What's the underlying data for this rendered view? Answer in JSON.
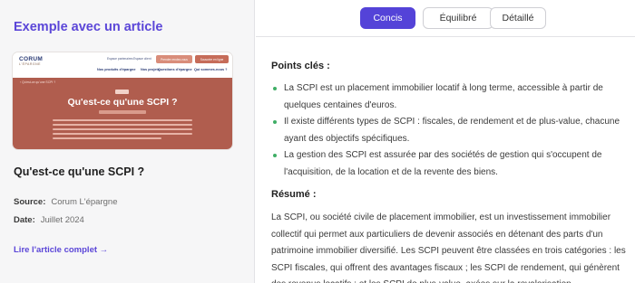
{
  "left_panel": {
    "heading": "Exemple avec un article",
    "thumbnail": {
      "logo": "CORUM",
      "logo_sub": "L'ÉPARGNE",
      "top_links": [
        "Espace partenaires",
        "Espace client"
      ],
      "buttons": [
        "Prendre rendez-vous",
        "Souscrire en ligne"
      ],
      "nav": [
        "Nos produits d'épargne",
        "Nos projets",
        "Questions d'épargne",
        "Qui sommes-nous ?"
      ],
      "breadcrumb": "›   Qu'est-ce qu'une SCPI ?",
      "headline": "Qu'est-ce qu'une SCPI ?"
    },
    "article_title": "Qu'est-ce qu'une SCPI ?",
    "source_label": "Source:",
    "source_value": "Corum L'épargne",
    "date_label": "Date:",
    "date_value": "Juillet 2024",
    "link_label": "Lire l'article complet →"
  },
  "tabs": [
    {
      "label": "Concis",
      "active": true
    },
    {
      "label": "Équilibré",
      "active": false
    },
    {
      "label": "Détaillé",
      "active": false
    }
  ],
  "content": {
    "key_points_heading": "Points clés :",
    "key_points": [
      "La SCPI est un placement immobilier locatif à long terme, accessible à partir de quelques centaines d'euros.",
      "Il existe différents types de SCPI : fiscales, de rendement et de plus-value, chacune ayant des objectifs spécifiques.",
      "La gestion des SCPI est assurée par des sociétés de gestion qui s'occupent de l'acquisition, de la location et de la revente des biens."
    ],
    "summary_heading": "Résumé :",
    "summary_text": "La SCPI, ou société civile de placement immobilier, est un investissement immobilier collectif qui permet aux particuliers de devenir associés en détenant des parts d'un patrimoine immobilier diversifié. Les SCPI peuvent être classées en trois catégories : les SCPI fiscales, qui offrent des avantages fiscaux ; les SCPI de rendement, qui génèrent des revenus locatifs ; et les SCPI de plus-value, axées sur la revalorisation"
  },
  "colors": {
    "accent": "#5443d8",
    "heading_purple": "#5b46d8",
    "bullet_green": "#3fae66",
    "thumb_hero": "#b05d4e"
  }
}
